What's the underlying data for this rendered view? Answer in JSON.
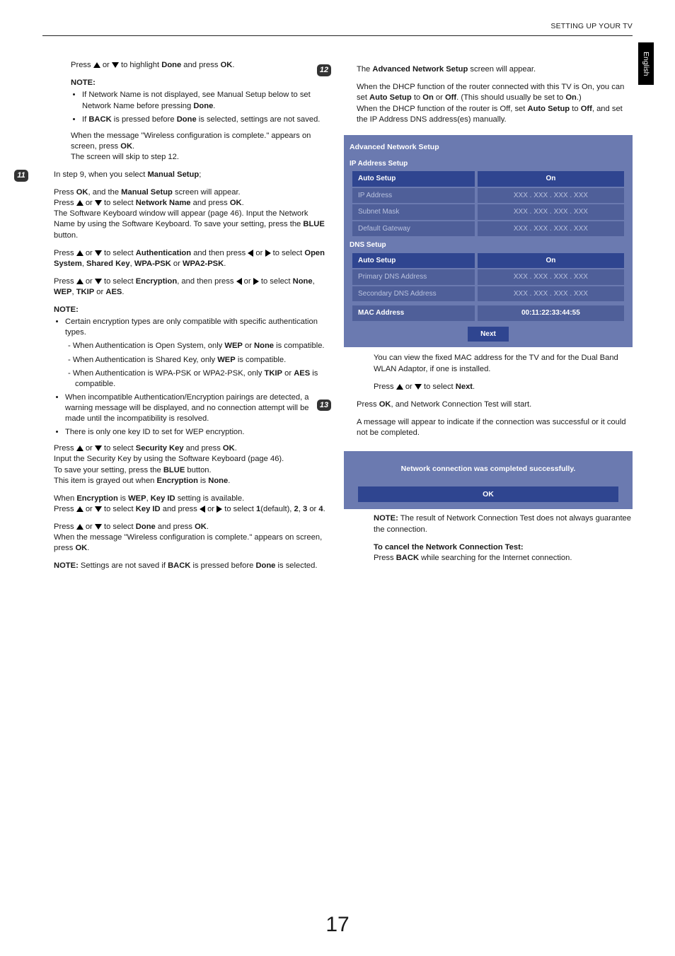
{
  "header": "SETTING UP YOUR TV",
  "side_tab": "English",
  "page_number": "17",
  "left": {
    "p_done": {
      "pre": "Press ",
      "mid": " or ",
      "post": " to highlight ",
      "done": "Done",
      "and": " and press ",
      "ok": "OK",
      "dot": "."
    },
    "note1_h": "NOTE:",
    "note1_li1": {
      "t1": "If Network Name is not displayed, see Manual Setup below to set Network Name before pressing ",
      "done": "Done",
      "dot": "."
    },
    "note1_li2": {
      "t1": "If ",
      "back": "BACK",
      "t2": " is pressed before ",
      "done": "Done",
      "t3": " is selected, settings are not saved."
    },
    "wifi_msg": {
      "t1": "When the message \"Wireless configuration is complete.\" appears on screen, press ",
      "ok": "OK",
      "t2": ".",
      "t3": "The screen will skip to step 12."
    },
    "step11_num": "11",
    "step11_intro": {
      "t1": "In step 9, when you select ",
      "ms": "Manual Setup",
      "t2": ";"
    },
    "s11_p1": {
      "t1": "Press ",
      "ok": "OK",
      "t2": ", and the ",
      "ms": "Manual Setup",
      "t3": " screen will appear.",
      "t4": "Press ",
      "t5": " or ",
      "t6": " to select ",
      "nn": "Network Name",
      "t7": " and press ",
      "ok2": "OK",
      "t8": ".",
      "t9": "The Software Keyboard window will appear (page 46). Input the Network Name by using the Software Keyboard. To save your setting, press the ",
      "blue": "BLUE",
      "t10": " button."
    },
    "s11_p2": {
      "t1": "Press ",
      "t2": " or ",
      "t3": " to select ",
      "auth": "Authentication",
      "t4": " and then press ",
      "t5": " or ",
      "t6": " to select ",
      "os": "Open System",
      "c1": ", ",
      "sk": "Shared Key",
      "c2": ", ",
      "wpa": "WPA-PSK",
      "or": " or ",
      "wpa2": "WPA2-PSK",
      "dot": "."
    },
    "s11_p3": {
      "t1": "Press ",
      "t2": " or ",
      "t3": " to select ",
      "enc": "Encryption",
      "t4": ", and then press ",
      "t5": " or ",
      "t6": " to select ",
      "none": "None",
      "c1": ", ",
      "wep": "WEP",
      "c2": ", ",
      "tkip": "TKIP",
      "or": " or ",
      "aes": "AES",
      "dot": "."
    },
    "note2_h": "NOTE:",
    "note2_li1": "Certain encryption types are only compatible with specific authentication types.",
    "note2_li1a": {
      "t1": "When Authentication is Open System, only ",
      "wep": "WEP",
      "or": " or ",
      "none": "None",
      "t2": " is compatible."
    },
    "note2_li1b": {
      "t1": "When Authentication is Shared Key, only ",
      "wep": "WEP",
      "t2": " is compatible."
    },
    "note2_li1c": {
      "t1": "When Authentication is WPA-PSK or WPA2-PSK, only ",
      "tkip": "TKIP",
      "or": " or ",
      "aes": "AES",
      "t2": " is compatible."
    },
    "note2_li2": "When incompatible Authentication/Encryption pairings are detected, a warning message will be displayed, and no connection attempt will be made until the incompatibility is resolved.",
    "note2_li3": "There is only one key ID to set for WEP encryption.",
    "s11_p4": {
      "t1": "Press ",
      "t2": " or ",
      "t3": " to select ",
      "sk": "Security Key",
      "t4": " and press ",
      "ok": "OK",
      "t5": ".",
      "t6": "Input the Security Key by using the Software Keyboard (page 46).",
      "t7": "To save your setting, press the ",
      "blue": "BLUE",
      "t8": " button.",
      "t9": "This item is grayed out when ",
      "enc": "Encryption",
      "is": " is ",
      "none": "None",
      "dot": "."
    },
    "s11_p5": {
      "t1": "When ",
      "enc": "Encryption",
      "is": " is ",
      "wep": "WEP",
      "c": ", ",
      "kid": "Key ID",
      "t2": " setting is available.",
      "t3": "Press ",
      "t4": " or ",
      "t5": " to select ",
      "kid2": "Key ID",
      "t6": " and press ",
      "t7": " or ",
      "t8": " to select ",
      "one": "1",
      "def": "(default), ",
      "two": "2",
      "c2": ", ",
      "three": "3",
      "or": " or ",
      "four": "4",
      "dot": "."
    },
    "s11_p6": {
      "t1": "Press ",
      "t2": " or ",
      "t3": " to select ",
      "done": "Done",
      "t4": " and press ",
      "ok": "OK",
      "t5": ".",
      "t6": "When the message \"Wireless configuration is complete.\" appears on screen, press ",
      "ok2": "OK",
      "t7": "."
    },
    "s11_p7": {
      "h": "NOTE:",
      "t1": " Settings are not saved if ",
      "back": "BACK",
      "t2": " is pressed before ",
      "done": "Done",
      "t3": " is selected."
    }
  },
  "right": {
    "step12_num": "12",
    "s12_p1": {
      "t1": "The ",
      "ans": "Advanced Network Setup",
      "t2": " screen will appear."
    },
    "s12_p2": {
      "t1": "When the DHCP function of the router connected with this TV is On, you can set ",
      "as": "Auto Setup",
      "to": " to ",
      "on": "On",
      "or": " or ",
      "off": "Off",
      "t2": ". (This should usually be set to ",
      "on2": "On",
      "t3": ".)",
      "t4": "When the DHCP function of the router is Off, set ",
      "as2": "Auto Setup",
      "to2": " to ",
      "off2": "Off",
      "t5": ", and set the IP Address DNS address(es) manually."
    },
    "panel": {
      "title": "Advanced Network Setup",
      "ip_section": "IP Address Setup",
      "rows_ip": [
        {
          "label": "Auto Setup",
          "value": "On",
          "selected": true,
          "muted": false
        },
        {
          "label": "IP Address",
          "value": "XXX . XXX . XXX . XXX",
          "selected": false,
          "muted": true
        },
        {
          "label": "Subnet Mask",
          "value": "XXX . XXX . XXX . XXX",
          "selected": false,
          "muted": true
        },
        {
          "label": "Default Gateway",
          "value": "XXX . XXX . XXX . XXX",
          "selected": false,
          "muted": true
        }
      ],
      "dns_section": "DNS Setup",
      "rows_dns": [
        {
          "label": "Auto Setup",
          "value": "On",
          "selected": true,
          "muted": false
        },
        {
          "label": "Primary DNS Address",
          "value": "XXX . XXX . XXX . XXX",
          "selected": false,
          "muted": true
        },
        {
          "label": "Secondary DNS Address",
          "value": "XXX . XXX . XXX . XXX",
          "selected": false,
          "muted": true
        }
      ],
      "mac_label": "MAC Address",
      "mac_value": "00:11:22:33:44:55",
      "next_btn": "Next"
    },
    "s12_p3": "You can view the fixed MAC address for the TV and for the Dual Band WLAN Adaptor, if one is installed.",
    "s12_p4": {
      "t1": "Press ",
      "t2": " or ",
      "t3": " to select ",
      "next": "Next",
      "dot": "."
    },
    "step13_num": "13",
    "s13_p1": {
      "t1": "Press ",
      "ok": "OK",
      "t2": ", and Network Connection Test will start."
    },
    "s13_p2": "A message will appear to indicate if the connection was successful or it could not be completed.",
    "panel2": {
      "msg": "Network connection was completed successfully.",
      "ok": "OK"
    },
    "s13_note": {
      "h": "NOTE:",
      "t": " The result of Network Connection Test does not always guarantee the connection."
    },
    "s13_cancel_h": "To cancel the Network Connection Test:",
    "s13_cancel": {
      "t1": "Press ",
      "back": "BACK",
      "t2": " while searching for the Internet connection."
    }
  }
}
